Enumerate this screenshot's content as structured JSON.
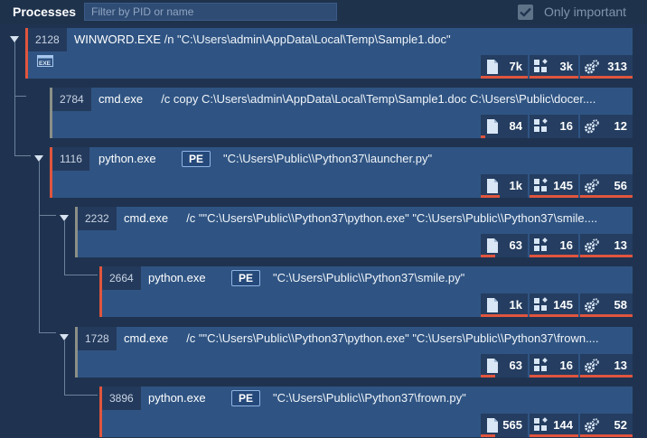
{
  "header": {
    "title": "Processes",
    "filter_placeholder": "Filter by PID or name",
    "only_important_label": "Only important",
    "only_important_checked": true
  },
  "colors": {
    "accent_bar": "#e0553e",
    "neutral_bar": "#8b8f86",
    "node_bg": "#2f5483",
    "metric_bg": "#243d60"
  },
  "processes": [
    {
      "pid": "2128",
      "name": "WINWORD.EXE",
      "pe": "",
      "cmd": "/n \"C:\\Users\\admin\\AppData\\Local\\Temp\\Sample1.doc\"",
      "files": "7k",
      "registry": "3k",
      "modules": "313",
      "important": true,
      "has_exe_icon": true
    },
    {
      "pid": "2784",
      "name": "cmd.exe",
      "pe": "",
      "cmd": "/c copy C:\\Users\\admin\\AppData\\Local\\Temp\\Sample1.doc C:\\Users\\Public\\docer....",
      "files": "84",
      "registry": "16",
      "modules": "12",
      "important": false
    },
    {
      "pid": "1116",
      "name": "python.exe",
      "pe": "PE",
      "cmd": "\"C:\\Users\\Public\\\\Python37\\launcher.py\"",
      "files": "1k",
      "registry": "145",
      "modules": "56",
      "important": true
    },
    {
      "pid": "2232",
      "name": "cmd.exe",
      "pe": "",
      "cmd": "/c \"\"C:\\Users\\Public\\\\Python37\\python.exe\" \"C:\\Users\\Public\\\\Python37\\smile....",
      "files": "63",
      "registry": "16",
      "modules": "13",
      "important": false
    },
    {
      "pid": "2664",
      "name": "python.exe",
      "pe": "PE",
      "cmd": "\"C:\\Users\\Public\\\\Python37\\smile.py\"",
      "files": "1k",
      "registry": "145",
      "modules": "58",
      "important": true
    },
    {
      "pid": "1728",
      "name": "cmd.exe",
      "pe": "",
      "cmd": "/c \"\"C:\\Users\\Public\\\\Python37\\python.exe\" \"C:\\Users\\Public\\\\Python37\\frown....",
      "files": "63",
      "registry": "16",
      "modules": "13",
      "important": false
    },
    {
      "pid": "3896",
      "name": "python.exe",
      "pe": "PE",
      "cmd": "\"C:\\Users\\Public\\\\Python37\\frown.py\"",
      "files": "565",
      "registry": "144",
      "modules": "52",
      "important": true
    }
  ],
  "icons": {
    "files": "file-icon",
    "registry": "registry-icon",
    "modules": "gears-icon",
    "exe": "exe-icon"
  }
}
